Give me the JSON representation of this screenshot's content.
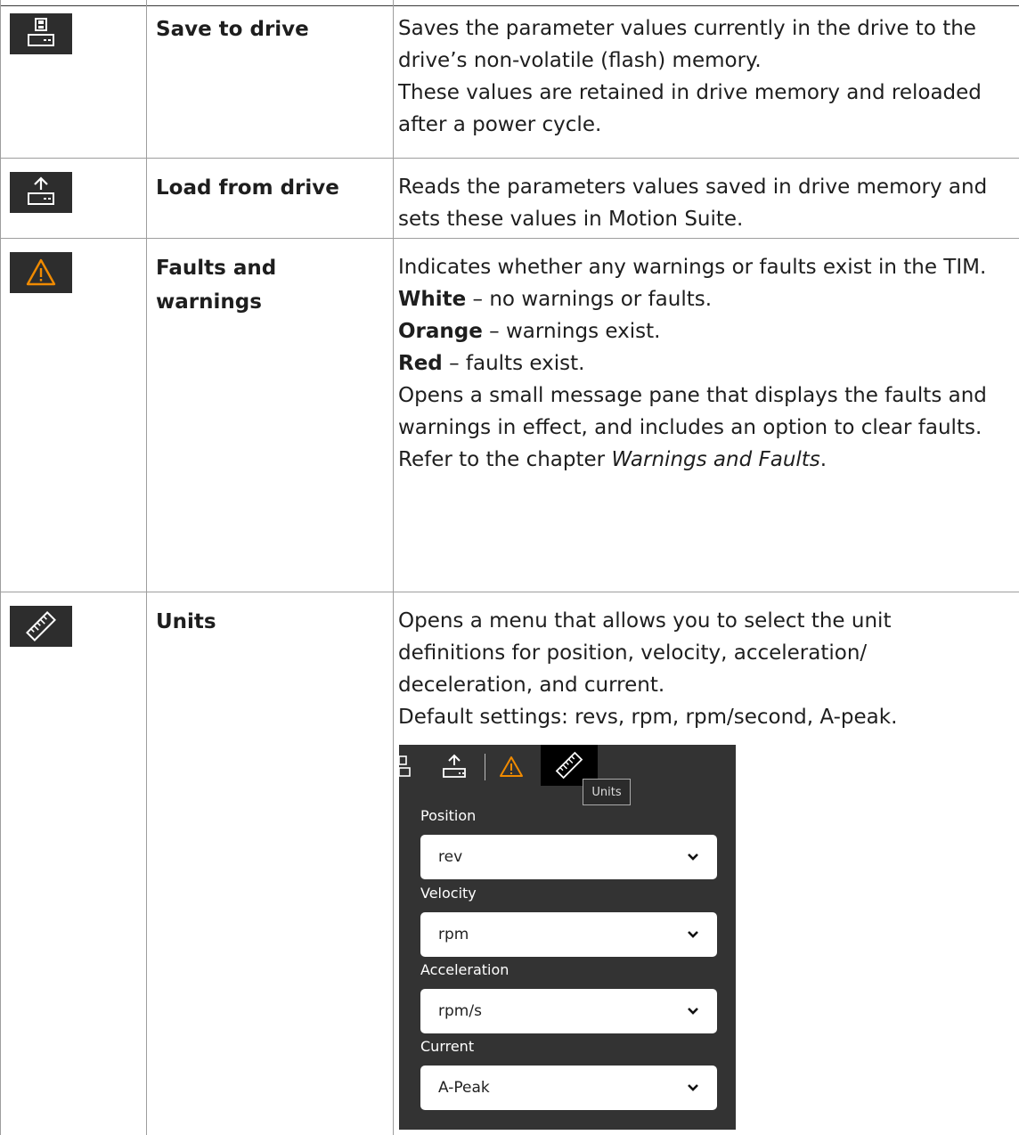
{
  "rows": [
    {
      "icon": "save-to-drive-icon",
      "name": "Save to drive",
      "desc": [
        "Saves the parameter values currently in the drive to the drive’s non-volatile (flash) memory.",
        "These values are retained in drive memory and reloaded after a power cycle."
      ]
    },
    {
      "icon": "load-from-drive-icon",
      "name": "Load from drive",
      "desc": [
        "Reads the parameters values saved in drive memory and sets these values in Motion Suite."
      ]
    },
    {
      "icon": "warning-icon",
      "name": "Faults and warnings",
      "desc": [
        "Indicates whether any warnings or faults exist in the TIM.",
        "Opens a small message pane that displays the faults and warnings in effect, and includes an option to clear faults."
      ],
      "states": [
        {
          "label": "White",
          "text": " – no warnings or faults."
        },
        {
          "label": "Orange",
          "text": " – warnings exist."
        },
        {
          "label": "Red",
          "text": " – faults exist."
        }
      ],
      "refer_prefix": "Refer to the chapter ",
      "refer_chapter": "Warnings and Faults",
      "refer_suffix": "."
    },
    {
      "icon": "ruler-icon",
      "name": "Units",
      "desc": [
        "Opens a menu that allows you to select the unit definitions for position, velocity, acceleration/ deceleration, and current.",
        "Default settings: revs, rpm, rpm/second, A-peak."
      ]
    }
  ],
  "units_panel": {
    "tooltip": "Units",
    "fields": [
      {
        "label": "Position",
        "value": "rev"
      },
      {
        "label": "Velocity",
        "value": "rpm"
      },
      {
        "label": "Acceleration",
        "value": "rpm/s"
      },
      {
        "label": "Current",
        "value": "A-Peak"
      }
    ]
  },
  "colors": {
    "icon_bg": "#2d2d2d",
    "warning": "#f08a00",
    "panel_bg": "#333333"
  }
}
